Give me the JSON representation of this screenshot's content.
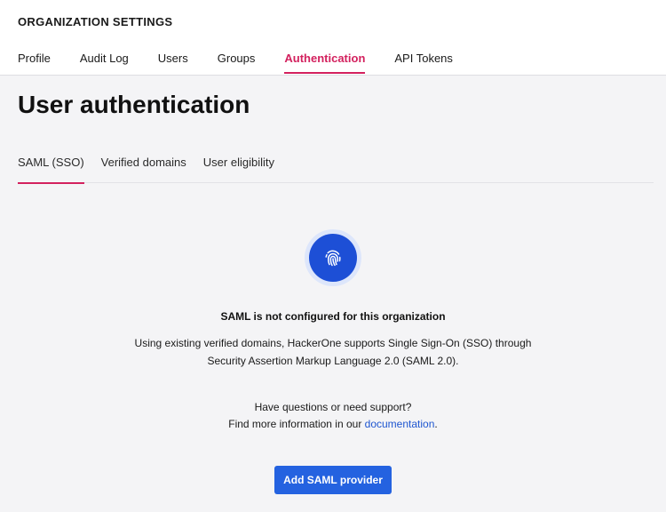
{
  "header": {
    "title": "ORGANIZATION SETTINGS",
    "tabs": [
      {
        "label": "Profile"
      },
      {
        "label": "Audit Log"
      },
      {
        "label": "Users"
      },
      {
        "label": "Groups"
      },
      {
        "label": "Authentication"
      },
      {
        "label": "API Tokens"
      }
    ],
    "active_tab": "Authentication"
  },
  "page": {
    "title": "User authentication",
    "sub_tabs": [
      {
        "label": "SAML (SSO)"
      },
      {
        "label": "Verified domains"
      },
      {
        "label": "User eligibility"
      }
    ],
    "active_sub_tab": "SAML (SSO)"
  },
  "empty_state": {
    "icon": "fingerprint-icon",
    "title": "SAML is not configured for this organization",
    "description_line1": "Using existing verified domains, HackerOne supports Single Sign-On (SSO) through",
    "description_line2": "Security Assertion Markup Language 2.0 (SAML 2.0).",
    "support_line1": "Have questions or need support?",
    "support_prefix": "Find more information in our ",
    "support_link": "documentation",
    "support_suffix": ".",
    "button_label": "Add SAML provider"
  },
  "colors": {
    "accent": "#d3215e",
    "primary": "#2462e0",
    "link": "#1f56d0",
    "background": "#f4f4f6"
  }
}
